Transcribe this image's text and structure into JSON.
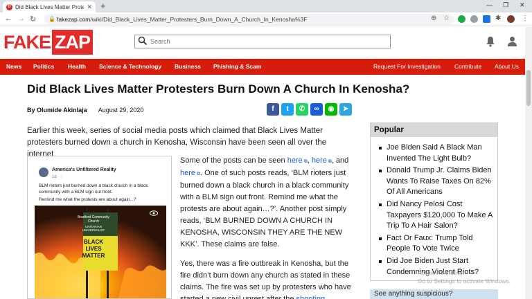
{
  "browser": {
    "tab_title": "Did Black Lives Matter Protesters",
    "tab_favicon": "D",
    "url_host": "fakezap.com",
    "url_path": "/wiki/Did_Black_Lives_Matter_Protesters_Burn_Down_A_Church_In_Kenosha%3F"
  },
  "site": {
    "logo_fake": "FAKE",
    "logo_zap": "ZAP",
    "search_placeholder": "Search"
  },
  "nav": {
    "left": [
      "News",
      "Politics",
      "Health",
      "Science & Technology",
      "Business",
      "Phishing & Scam"
    ],
    "right": [
      "Request For Investigation",
      "Contribute",
      "About Us"
    ]
  },
  "article": {
    "title": "Did Black Lives Matter Protesters Burn Down A Church In Kenosha?",
    "author": "By Olumide Akinlaja",
    "date": "August 29, 2020",
    "lead": "Earlier this week, series of social media posts which claimed that Black Lives Matter protesters burned down a church in Kenosha, Wisconsin have been seen all over the internet.",
    "p1_a": "Some of the posts can be seen ",
    "link_here": "here",
    "p1_sep": ", ",
    "p1_and": ", and ",
    "p1_b": ". One of such posts reads, ‘BLM rioters just burned down a black church in a black community with a BLM sign out front. Remind me what the protests are about again…?’. Another post simply reads, ‘BLM BURNED DOWN A CHURCH IN KENOSHA, WISCONSIN THEY ARE THE NEW KKK’. These claims are false.",
    "p2": "Yes, there was a fire outbreak in Kenosha, but the fire didn’t burn down any church as stated in these claims. The fire was set up by protesters who have started a new civil unrest after the ",
    "p2_link": "shooting"
  },
  "embed": {
    "account": "America's Unfiltered Reality",
    "ago": "1d · ",
    "post_line1": "BLM rioters just burned down a black church in a black community with a BLM sign out front.",
    "post_line2": "Remind me what the protests are about again...?",
    "sign_top": "Bradford Community Church",
    "sign_mid": "UNITARIAN UNIVERSALIST",
    "sign_blm": "BLACK LIVES MATTER"
  },
  "sidebar": {
    "popular_title": "Popular",
    "popular": [
      "Joe Biden Said A Black Man Invented The Light Bulb?",
      "Donald Trump Jr. Claims Biden Wants To Raise Taxes On 82% Of All Americans",
      "Did Nancy Pelosi Cost Taxpayers $120,000 To Make A Trip To A Hair Salon?",
      "Fact Or Faux: Trump Told People To Vote Twice",
      "Did Joe Biden Just Start Condemning Violent Riots?"
    ],
    "suspicious_label": "See anything suspicious?"
  },
  "watermark": {
    "line1": "Activate Windows",
    "line2": "Go to Settings to activate Windows."
  },
  "colors": {
    "brand_red": "#d61c0b",
    "facebook": "#3b5998",
    "twitter": "#1da1f2",
    "whatsapp": "#25d366",
    "link": "#1a5bd6",
    "line": "#00b900",
    "telegram": "#2ca5e0"
  }
}
